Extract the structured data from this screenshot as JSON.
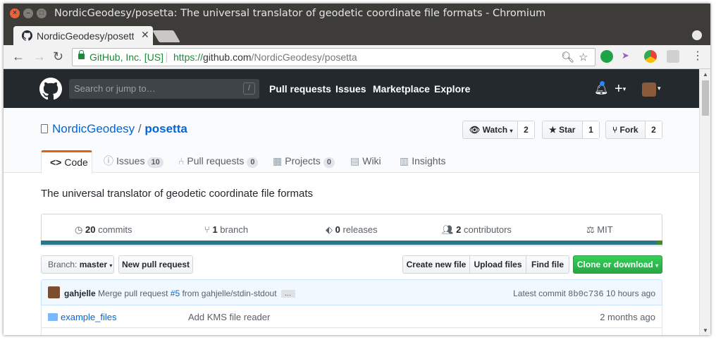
{
  "window": {
    "title": "NordicGeodesy/posetta: The universal translator of geodetic coordinate file formats - Chromium"
  },
  "tab": {
    "label": "NordicGeodesy/posetta"
  },
  "omnibox": {
    "security_name": "GitHub, Inc. [US]",
    "url_scheme": "https://",
    "url_host": "github.com",
    "url_path": "/NordicGeodesy/posetta"
  },
  "github_header": {
    "search_placeholder": "Search or jump to…",
    "search_key": "/",
    "nav": [
      "Pull requests",
      "Issues",
      "Marketplace",
      "Explore"
    ]
  },
  "repo": {
    "owner": "NordicGeodesy",
    "separator": "/",
    "name": "posetta",
    "watch": {
      "label": "Watch",
      "count": "2"
    },
    "star": {
      "label": "Star",
      "count": "1"
    },
    "fork": {
      "label": "Fork",
      "count": "2"
    },
    "tabs": [
      {
        "label": "Code",
        "count": ""
      },
      {
        "label": "Issues",
        "count": "10"
      },
      {
        "label": "Pull requests",
        "count": "0"
      },
      {
        "label": "Projects",
        "count": "0"
      },
      {
        "label": "Wiki",
        "count": ""
      },
      {
        "label": "Insights",
        "count": ""
      }
    ],
    "description": "The universal translator of geodetic coordinate file formats",
    "summary": {
      "commits_num": "20",
      "commits_label": "commits",
      "branch_num": "1",
      "branch_label": "branch",
      "releases_num": "0",
      "releases_label": "releases",
      "contributors_num": "2",
      "contributors_label": "contributors",
      "license": "MIT"
    },
    "language_colors": {
      "primary": "#2b7489",
      "secondary": "#3e8a2e"
    },
    "toolbar": {
      "branch_prefix": "Branch:",
      "branch_name": "master",
      "new_pr": "New pull request",
      "create_file": "Create new file",
      "upload_files": "Upload files",
      "find_file": "Find file",
      "clone": "Clone or download"
    },
    "latest_commit": {
      "author": "gahjelle",
      "message_pre": "Merge pull request",
      "pr_link": "#5",
      "message_post": "from gahjelle/stdin-stdout",
      "ellipsis": "…",
      "latest_label": "Latest commit",
      "sha": "8b0c736",
      "age": "10 hours ago"
    },
    "files": [
      {
        "name": "example_files",
        "message": "Add KMS file reader",
        "age": "2 months ago"
      }
    ]
  }
}
